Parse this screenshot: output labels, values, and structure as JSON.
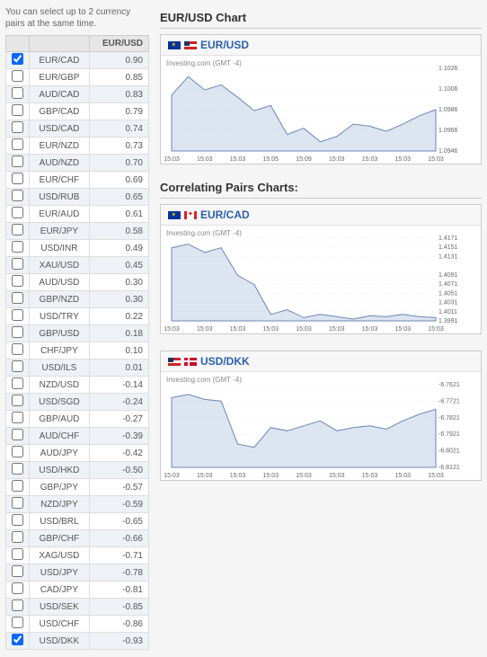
{
  "instruction": "You can select up to 2\ncurrency pairs at the same time.",
  "table": {
    "headers": [
      "",
      "",
      "EUR/USD"
    ],
    "rows": [
      {
        "checked": true,
        "pair": "EUR/CAD",
        "val": "0.90"
      },
      {
        "checked": false,
        "pair": "EUR/GBP",
        "val": "0.85"
      },
      {
        "checked": false,
        "pair": "AUD/CAD",
        "val": "0.83"
      },
      {
        "checked": false,
        "pair": "GBP/CAD",
        "val": "0.79"
      },
      {
        "checked": false,
        "pair": "USD/CAD",
        "val": "0.74"
      },
      {
        "checked": false,
        "pair": "EUR/NZD",
        "val": "0.73"
      },
      {
        "checked": false,
        "pair": "AUD/NZD",
        "val": "0.70"
      },
      {
        "checked": false,
        "pair": "EUR/CHF",
        "val": "0.69"
      },
      {
        "checked": false,
        "pair": "USD/RUB",
        "val": "0.65"
      },
      {
        "checked": false,
        "pair": "EUR/AUD",
        "val": "0.61"
      },
      {
        "checked": false,
        "pair": "EUR/JPY",
        "val": "0.58"
      },
      {
        "checked": false,
        "pair": "USD/INR",
        "val": "0.49"
      },
      {
        "checked": false,
        "pair": "XAU/USD",
        "val": "0.45"
      },
      {
        "checked": false,
        "pair": "AUD/USD",
        "val": "0.30"
      },
      {
        "checked": false,
        "pair": "GBP/NZD",
        "val": "0.30"
      },
      {
        "checked": false,
        "pair": "USD/TRY",
        "val": "0.22"
      },
      {
        "checked": false,
        "pair": "GBP/USD",
        "val": "0.18"
      },
      {
        "checked": false,
        "pair": "CHF/JPY",
        "val": "0.10"
      },
      {
        "checked": false,
        "pair": "USD/ILS",
        "val": "0.01"
      },
      {
        "checked": false,
        "pair": "NZD/USD",
        "val": "-0.14"
      },
      {
        "checked": false,
        "pair": "USD/SGD",
        "val": "-0.24"
      },
      {
        "checked": false,
        "pair": "GBP/AUD",
        "val": "-0.27"
      },
      {
        "checked": false,
        "pair": "AUD/CHF",
        "val": "-0.39"
      },
      {
        "checked": false,
        "pair": "AUD/JPY",
        "val": "-0.42"
      },
      {
        "checked": false,
        "pair": "USD/HKD",
        "val": "-0.50"
      },
      {
        "checked": false,
        "pair": "GBP/JPY",
        "val": "-0.57"
      },
      {
        "checked": false,
        "pair": "NZD/JPY",
        "val": "-0.59"
      },
      {
        "checked": false,
        "pair": "USD/BRL",
        "val": "-0.65"
      },
      {
        "checked": false,
        "pair": "GBP/CHF",
        "val": "-0.66"
      },
      {
        "checked": false,
        "pair": "XAG/USD",
        "val": "-0.71"
      },
      {
        "checked": false,
        "pair": "USD/JPY",
        "val": "-0.78"
      },
      {
        "checked": false,
        "pair": "CAD/JPY",
        "val": "-0.81"
      },
      {
        "checked": false,
        "pair": "USD/SEK",
        "val": "-0.85"
      },
      {
        "checked": false,
        "pair": "USD/CHF",
        "val": "-0.86"
      },
      {
        "checked": true,
        "pair": "USD/DKK",
        "val": "-0.93"
      }
    ]
  },
  "right": {
    "main_title": "EUR/USD Chart",
    "correl_title": "Correlating Pairs Charts:",
    "src_label": "Investing.com (GMT -4)"
  },
  "charts": [
    {
      "label": "EUR/USD",
      "flags": [
        "eu",
        "us"
      ]
    },
    {
      "label": "EUR/CAD",
      "flags": [
        "eu",
        "ca"
      ]
    },
    {
      "label": "USD/DKK",
      "flags": [
        "us",
        "dk"
      ]
    }
  ],
  "chart_data": [
    {
      "type": "area",
      "title": "EUR/USD",
      "xlabel": "",
      "ylabel": "",
      "ylim": [
        1.0946,
        1.1026
      ],
      "yticks": [
        "1.1026",
        "1.1006",
        "1.0986",
        "1.0966",
        "1.0946"
      ],
      "xticks": [
        "15:03",
        "15:03",
        "15:03",
        "15:05",
        "15:09",
        "15:03",
        "15:03",
        "15:03",
        "15:03"
      ],
      "values": [
        1.1,
        1.1018,
        1.1005,
        1.101,
        1.0998,
        1.0985,
        1.099,
        1.0962,
        1.0968,
        1.0955,
        1.096,
        1.0972,
        1.097,
        1.0965,
        1.0972,
        1.098,
        1.0986
      ]
    },
    {
      "type": "area",
      "title": "EUR/CAD",
      "xlabel": "",
      "ylabel": "",
      "ylim": [
        1.3991,
        1.4171
      ],
      "yticks": [
        "1.4171",
        "1.4151",
        "1.4131",
        "1.4091",
        "1.4071",
        "1.4051",
        "1.4031",
        "1.4011",
        "1.3991"
      ],
      "xticks": [
        "15:03",
        "15:03",
        "15:03",
        "15:03",
        "15:03",
        "15:03",
        "15:03",
        "15:03",
        "15:03"
      ],
      "values": [
        1.415,
        1.4158,
        1.414,
        1.415,
        1.409,
        1.407,
        1.4005,
        1.4015,
        1.3998,
        1.4005,
        1.4,
        1.3995,
        1.4002,
        1.4,
        1.4005,
        1.4,
        1.3998
      ]
    },
    {
      "type": "area",
      "title": "USD/DKK",
      "xlabel": "",
      "ylabel": "",
      "ylim": [
        -6.8121,
        -6.7621
      ],
      "yticks": [
        "-6.8121",
        "-6.8021",
        "-6.7921",
        "-6.7821",
        "-6.7721",
        "-6.7621"
      ],
      "xticks": [
        "15:03",
        "15:03",
        "15:03",
        "15:03",
        "15:03",
        "15:03",
        "15:03",
        "15:03",
        "15:03"
      ],
      "values": [
        -6.77,
        -6.768,
        -6.771,
        -6.772,
        -6.798,
        -6.8,
        -6.788,
        -6.79,
        -6.787,
        -6.784,
        -6.79,
        -6.788,
        -6.787,
        -6.789,
        -6.784,
        -6.78,
        -6.777
      ]
    }
  ]
}
